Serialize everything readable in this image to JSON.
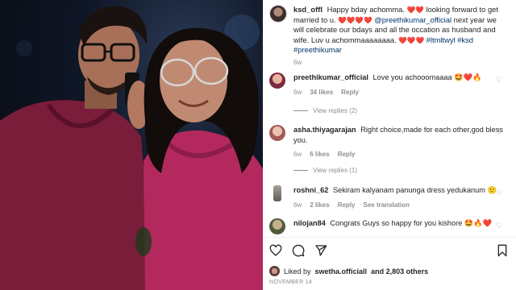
{
  "post": {
    "author": "ksd_offl",
    "caption_text_1": "Happy bday achomma.",
    "caption_text_2": "looking forward to get married to u.",
    "caption_mention": "@preethikumar_official",
    "caption_text_3": "next year we will celebrate our bdays and all the occation as husband and wife. Luv u achommaaaaaaaa.",
    "caption_hashtags": "#ltmltwyl #ksd #preethikumar",
    "caption_time": "6w"
  },
  "comments": [
    {
      "username": "preethikumar_official",
      "text": "Love you achooomaaaa",
      "emoji": "🤩❤️🔥",
      "time": "6w",
      "likes": "34 likes",
      "reply": "Reply",
      "view_replies": "View replies (2)",
      "avatar_color": "#d9a58a"
    },
    {
      "username": "asha.thiyagarajan",
      "text": "Right choice,made for each other,god bless you.",
      "emoji": "",
      "time": "6w",
      "likes": "6 likes",
      "reply": "Reply",
      "view_replies": "View replies (1)",
      "avatar_color": "#c98a86"
    },
    {
      "username": "roshni_62",
      "text": "Sekiram kalyanam panunga dress yedukanum",
      "emoji": "🙂",
      "time": "6w",
      "likes": "2 likes",
      "reply": "Reply",
      "see_translation": "See translation",
      "avatar_color": "#8c8a80"
    },
    {
      "username": "nilojan84",
      "text": "Congrats Guys so happy for you kishore",
      "emoji": "🤩🔥❤️",
      "avatar_color": "#6c7a5a"
    }
  ],
  "footer": {
    "liked_by_prefix": "Liked by",
    "liked_by_user": "swetha.officiall",
    "liked_by_suffix": "and 2,803 others",
    "date": "NOVEMBER 14"
  },
  "icons": [
    "heart-icon",
    "comment-icon",
    "share-icon",
    "bookmark-icon"
  ],
  "colors": {
    "heart": "#e0245e",
    "link": "#00376b",
    "muted": "#8e8e8e"
  }
}
